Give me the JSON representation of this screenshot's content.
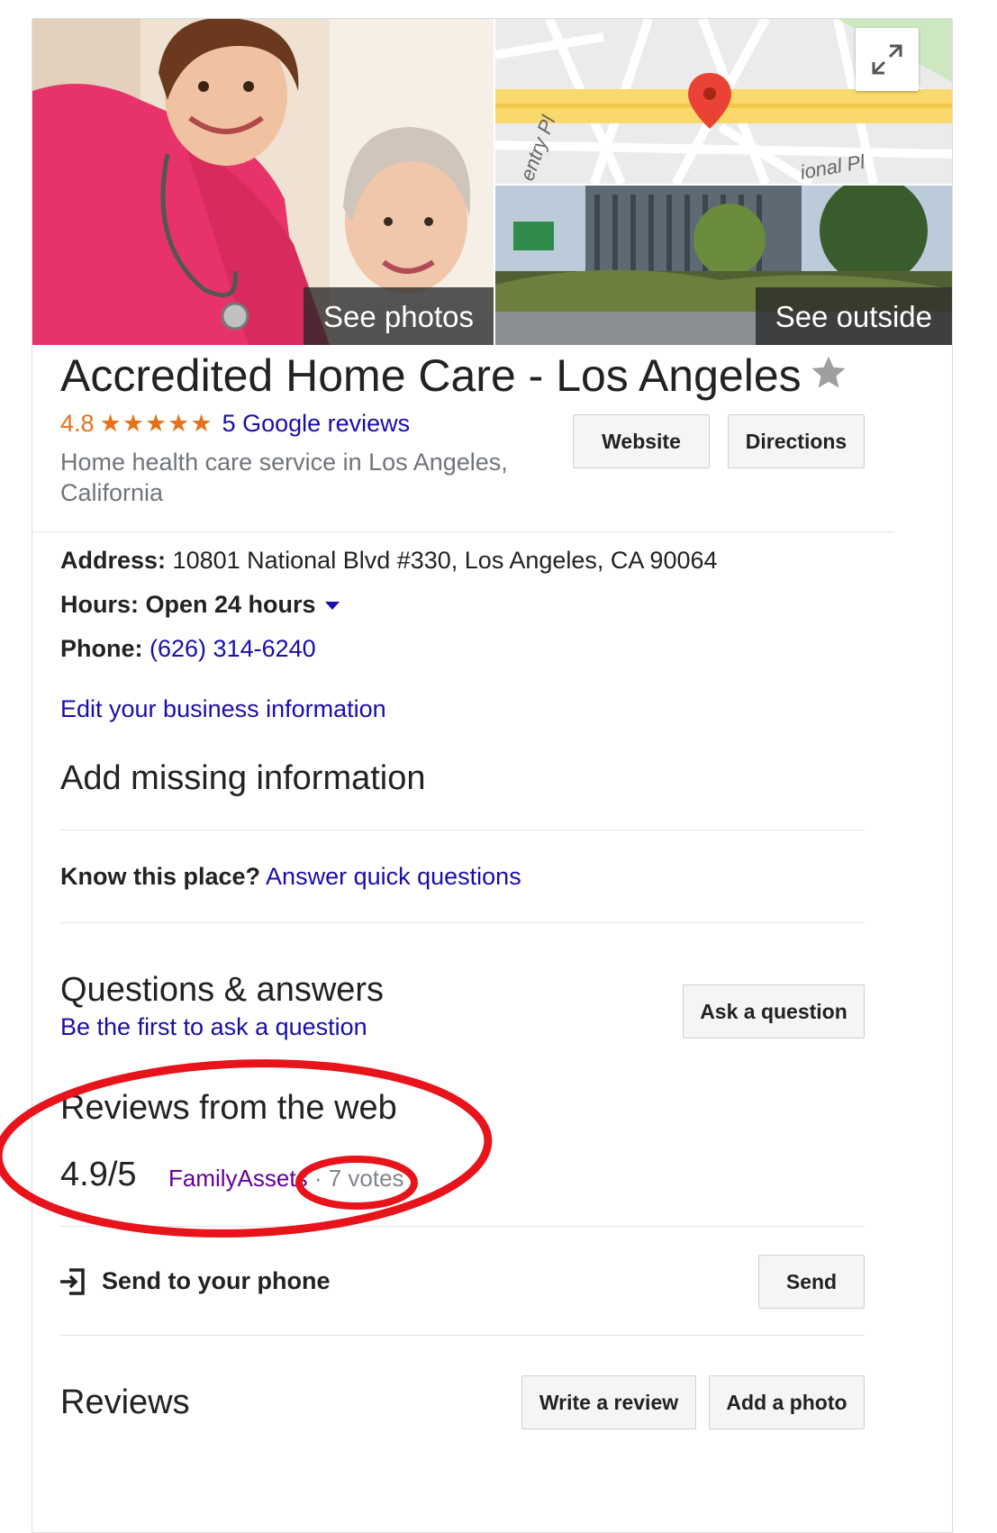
{
  "images": {
    "see_photos": "See photos",
    "see_outside": "See outside",
    "map_street_1": "entry Pl",
    "map_street_2": "ional Pl"
  },
  "business": {
    "name": "Accredited Home Care - Los Angeles",
    "rating": "4.8",
    "stars": "★★★★★",
    "reviews_link": "5 Google reviews",
    "category": "Home health care service in Los Angeles, California"
  },
  "actions": {
    "website": "Website",
    "directions": "Directions"
  },
  "info": {
    "address_label": "Address:",
    "address_value": "10801 National Blvd #330, Los Angeles, CA 90064",
    "hours_label": "Hours:",
    "hours_value": "Open 24 hours",
    "phone_label": "Phone:",
    "phone_value": "(626) 314-6240",
    "edit_link": "Edit your business information",
    "add_missing": "Add missing information"
  },
  "know_place": {
    "label": "Know this place?",
    "link": "Answer quick questions"
  },
  "qa": {
    "title": "Questions & answers",
    "link": "Be the first to ask a question",
    "button": "Ask a question"
  },
  "web_reviews": {
    "title": "Reviews from the web",
    "score": "4.9/5",
    "source": "FamilyAssets",
    "separator": "·",
    "votes": "7 votes"
  },
  "send": {
    "label": "Send to your phone",
    "button": "Send"
  },
  "reviews": {
    "title": "Reviews",
    "write": "Write a review",
    "add_photo": "Add a photo"
  },
  "colors": {
    "accent_link": "#1a0dab",
    "rating_orange": "#e7711b",
    "annotation_red": "#e8131b",
    "map_pin": "#ea4335"
  }
}
